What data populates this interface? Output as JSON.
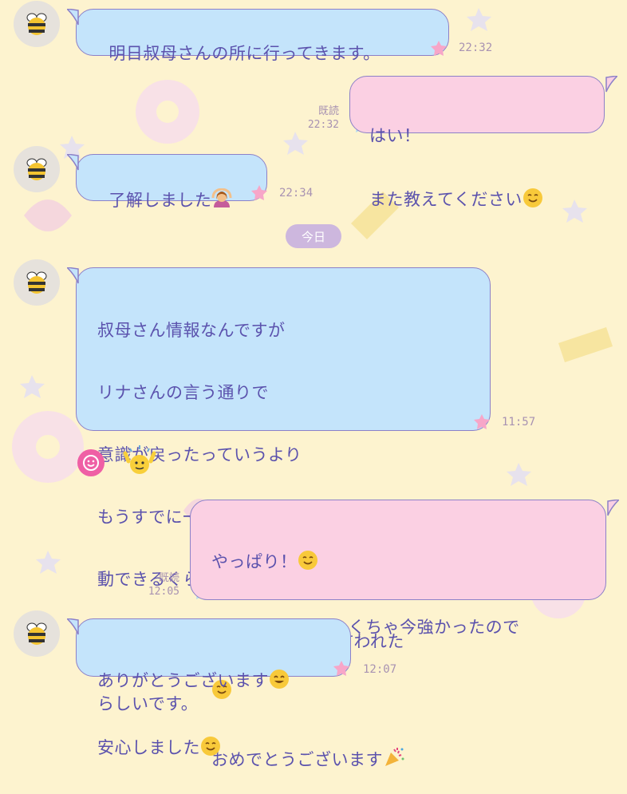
{
  "date_separator": "今日",
  "read_label": "既読",
  "messages": [
    {
      "text": "明日叔母さんの所に行ってきます。",
      "time": "22:32"
    },
    {
      "line1": "はい！",
      "line2": "また教えてください",
      "time": "22:32"
    },
    {
      "text": "了解しました",
      "time": "22:34"
    },
    {
      "lines": [
        "叔母さん情報なんですが",
        "リナさんの言う通りで",
        "意識が戻ったっていうより",
        "もうすでに一般病棟に移って車椅子で移",
        "動できるくらい回復してました。",
        "生命力が凄く強いって医者にも言われた",
        "らしいです。"
      ],
      "time": "11:57"
    },
    {
      "line1": "やっぱり！",
      "line2": "生きる力がめちゃくちゃ今強かったので",
      "line4": "おめでとうございます",
      "time": "12:05"
    },
    {
      "line1": "ありがとうございます",
      "line2": "安心しました",
      "time": "12:07"
    }
  ],
  "colors": {
    "incoming_bubble": "#c4e4fb",
    "outgoing_bubble": "#fbd0e3",
    "text": "#5b52ad",
    "background": "#fdf3cf"
  }
}
